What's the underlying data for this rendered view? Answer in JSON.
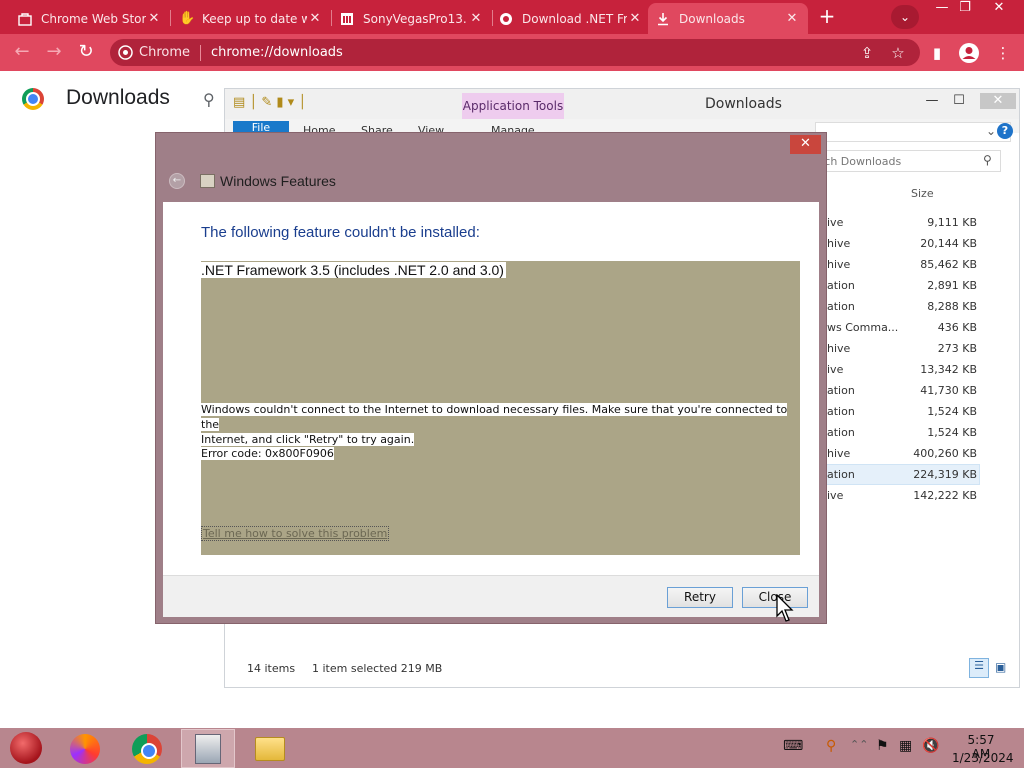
{
  "browser": {
    "tabs": [
      {
        "title": "Chrome Web Store",
        "favicon": "store-icon",
        "active": false
      },
      {
        "title": "Keep up to date w",
        "favicon": "hand-icon",
        "active": false
      },
      {
        "title": "SonyVegasPro13.",
        "favicon": "bank-icon",
        "active": false
      },
      {
        "title": "Download .NET Fr",
        "favicon": "web-icon",
        "active": false
      },
      {
        "title": "Downloads",
        "favicon": "download-icon",
        "active": true
      }
    ],
    "new_tab": "+",
    "omnibox_site": "Chrome",
    "omnibox_url": "chrome://downloads",
    "accent": "#c7223c"
  },
  "downloads_page": {
    "title": "Downloads"
  },
  "explorer": {
    "title": "Downloads",
    "contextual_tab": "Application Tools",
    "ribbon_tabs": {
      "file": "File",
      "home": "Home",
      "share": "Share",
      "view": "View",
      "manage": "Manage"
    },
    "search_placeholder": "rch Downloads",
    "column_size": "Size",
    "rows": [
      {
        "type": "ive",
        "size": "9,111 KB"
      },
      {
        "type": "hive",
        "size": "20,144 KB"
      },
      {
        "type": "hive",
        "size": "85,462 KB"
      },
      {
        "type": "ation",
        "size": "2,891 KB"
      },
      {
        "type": "ation",
        "size": "8,288 KB"
      },
      {
        "type": "ws Comma...",
        "size": "436 KB"
      },
      {
        "type": "hive",
        "size": "273 KB"
      },
      {
        "type": "ive",
        "size": "13,342 KB"
      },
      {
        "type": "ation",
        "size": "41,730 KB"
      },
      {
        "type": "ation",
        "size": "1,524 KB"
      },
      {
        "type": "ation",
        "size": "1,524 KB"
      },
      {
        "type": "hive",
        "size": "400,260 KB"
      },
      {
        "type": "ation",
        "size": "224,319 KB"
      },
      {
        "type": "ive",
        "size": "142,222 KB"
      }
    ],
    "status_items": "14 items",
    "status_selected": "1 item selected  219 MB"
  },
  "dialog": {
    "title": "Windows Features",
    "heading": "The following feature couldn't be installed:",
    "feature": ".NET Framework 3.5 (includes .NET 2.0 and 3.0)",
    "message_line1": "Windows couldn't connect to the Internet to download necessary files. Make sure that you're connected to the",
    "message_line2": "Internet, and click \"Retry\" to try again.",
    "error_code": "Error code: 0x800F0906",
    "help_link": "Tell me how to solve this problem",
    "retry_label": "Retry",
    "close_label": "Close",
    "close_x": "✕"
  },
  "taskbar": {
    "time": "5:57 AM",
    "date": "1/23/2024"
  }
}
